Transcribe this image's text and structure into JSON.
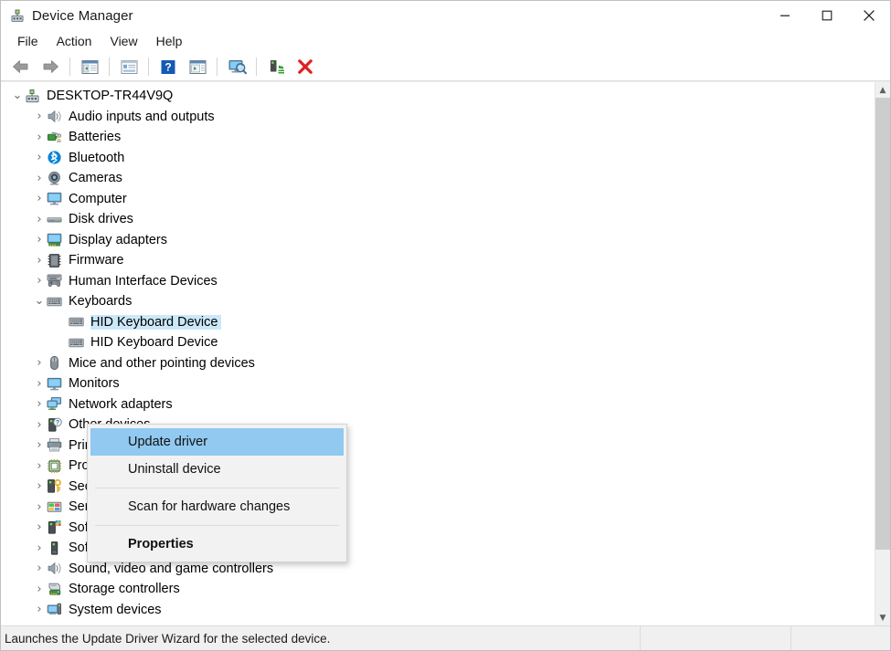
{
  "window": {
    "title": "Device Manager",
    "title_icon": "device-manager-icon",
    "controls": [
      {
        "name": "minimize-button",
        "glyph": "minimize-icon"
      },
      {
        "name": "maximize-button",
        "glyph": "maximize-icon"
      },
      {
        "name": "close-button",
        "glyph": "close-icon"
      }
    ]
  },
  "menubar": {
    "items": [
      {
        "label": "File"
      },
      {
        "label": "Action"
      },
      {
        "label": "View"
      },
      {
        "label": "Help"
      }
    ]
  },
  "toolbar": {
    "buttons": [
      {
        "name": "back-button",
        "icon": "back-arrow-icon"
      },
      {
        "name": "forward-button",
        "icon": "forward-arrow-icon"
      },
      {
        "name": "separator-1",
        "icon": "separator"
      },
      {
        "name": "show-hide-console-tree-button",
        "icon": "console-tree-icon"
      },
      {
        "name": "separator-2",
        "icon": "separator"
      },
      {
        "name": "properties-button",
        "icon": "properties-icon"
      },
      {
        "name": "separator-3",
        "icon": "separator"
      },
      {
        "name": "help-button",
        "icon": "help-question-icon"
      },
      {
        "name": "show-hide-action-pane-button",
        "icon": "action-pane-icon"
      },
      {
        "name": "separator-4",
        "icon": "separator"
      },
      {
        "name": "scan-for-hardware-changes-button",
        "icon": "scan-monitor-icon"
      },
      {
        "name": "separator-5",
        "icon": "separator"
      },
      {
        "name": "update-driver-button",
        "icon": "update-driver-icon"
      },
      {
        "name": "uninstall-device-button",
        "icon": "uninstall-x-icon"
      }
    ]
  },
  "tree": {
    "nodes": [
      {
        "label": "DESKTOP-TR44V9Q",
        "depth": 0,
        "state": "expanded",
        "icon": "computer-root-icon",
        "selected": false
      },
      {
        "label": "Audio inputs and outputs",
        "depth": 1,
        "state": "collapsed",
        "icon": "speaker-icon",
        "selected": false
      },
      {
        "label": "Batteries",
        "depth": 1,
        "state": "collapsed",
        "icon": "battery-icon",
        "selected": false
      },
      {
        "label": "Bluetooth",
        "depth": 1,
        "state": "collapsed",
        "icon": "bluetooth-icon",
        "selected": false
      },
      {
        "label": "Cameras",
        "depth": 1,
        "state": "collapsed",
        "icon": "camera-icon",
        "selected": false
      },
      {
        "label": "Computer",
        "depth": 1,
        "state": "collapsed",
        "icon": "monitor-icon",
        "selected": false
      },
      {
        "label": "Disk drives",
        "depth": 1,
        "state": "collapsed",
        "icon": "disk-drive-icon",
        "selected": false
      },
      {
        "label": "Display adapters",
        "depth": 1,
        "state": "collapsed",
        "icon": "display-adapter-icon",
        "selected": false
      },
      {
        "label": "Firmware",
        "depth": 1,
        "state": "collapsed",
        "icon": "firmware-chip-icon",
        "selected": false
      },
      {
        "label": "Human Interface Devices",
        "depth": 1,
        "state": "collapsed",
        "icon": "hid-gamepad-icon",
        "selected": false
      },
      {
        "label": "Keyboards",
        "depth": 1,
        "state": "expanded",
        "icon": "keyboard-icon",
        "selected": false
      },
      {
        "label": "HID Keyboard Device",
        "depth": 2,
        "state": "leaf",
        "icon": "keyboard-device-icon",
        "selected": true
      },
      {
        "label": "HID Keyboard Device",
        "depth": 2,
        "state": "leaf",
        "icon": "keyboard-device-icon",
        "selected": false
      },
      {
        "label": "Mice and other pointing devices",
        "depth": 1,
        "state": "collapsed",
        "icon": "mouse-icon",
        "selected": false
      },
      {
        "label": "Monitors",
        "depth": 1,
        "state": "collapsed",
        "icon": "monitor-icon",
        "selected": false
      },
      {
        "label": "Network adapters",
        "depth": 1,
        "state": "collapsed",
        "icon": "network-adapter-icon",
        "selected": false
      },
      {
        "label": "Other devices",
        "depth": 1,
        "state": "collapsed",
        "icon": "other-device-icon",
        "selected": false
      },
      {
        "label": "Print queues",
        "depth": 1,
        "state": "collapsed",
        "icon": "printer-icon",
        "selected": false
      },
      {
        "label": "Processors",
        "depth": 1,
        "state": "collapsed",
        "icon": "processor-icon",
        "selected": false
      },
      {
        "label": "Security devices",
        "depth": 1,
        "state": "collapsed",
        "icon": "security-key-icon",
        "selected": false
      },
      {
        "label": "Sensors",
        "depth": 1,
        "state": "collapsed",
        "icon": "sensor-icon",
        "selected": false
      },
      {
        "label": "Software components",
        "depth": 1,
        "state": "collapsed",
        "icon": "software-component-icon",
        "selected": false
      },
      {
        "label": "Software devices",
        "depth": 1,
        "state": "collapsed",
        "icon": "software-device-icon",
        "selected": false
      },
      {
        "label": "Sound, video and game controllers",
        "depth": 1,
        "state": "collapsed",
        "icon": "sound-controller-icon",
        "selected": false
      },
      {
        "label": "Storage controllers",
        "depth": 1,
        "state": "collapsed",
        "icon": "storage-controller-icon",
        "selected": false
      },
      {
        "label": "System devices",
        "depth": 1,
        "state": "collapsed",
        "icon": "system-device-icon",
        "selected": false
      }
    ]
  },
  "context_menu": {
    "items": [
      {
        "label": "Update driver",
        "highlighted": true,
        "bold": false,
        "type": "item"
      },
      {
        "label": "Uninstall device",
        "highlighted": false,
        "bold": false,
        "type": "item"
      },
      {
        "type": "separator"
      },
      {
        "label": "Scan for hardware changes",
        "highlighted": false,
        "bold": false,
        "type": "item"
      },
      {
        "type": "separator"
      },
      {
        "label": "Properties",
        "highlighted": false,
        "bold": true,
        "type": "item"
      }
    ]
  },
  "statusbar": {
    "message": "Launches the Update Driver Wizard for the selected device.",
    "panel2": "",
    "panel3": ""
  },
  "colors": {
    "selection_blue": "#cbe8f9",
    "menu_highlight_blue": "#91c9f0",
    "chrome_gray": "#f0f0f0",
    "close_red": "#e81123",
    "accent_bluetooth": "#0a84d8",
    "uninstall_red": "#e02020"
  }
}
